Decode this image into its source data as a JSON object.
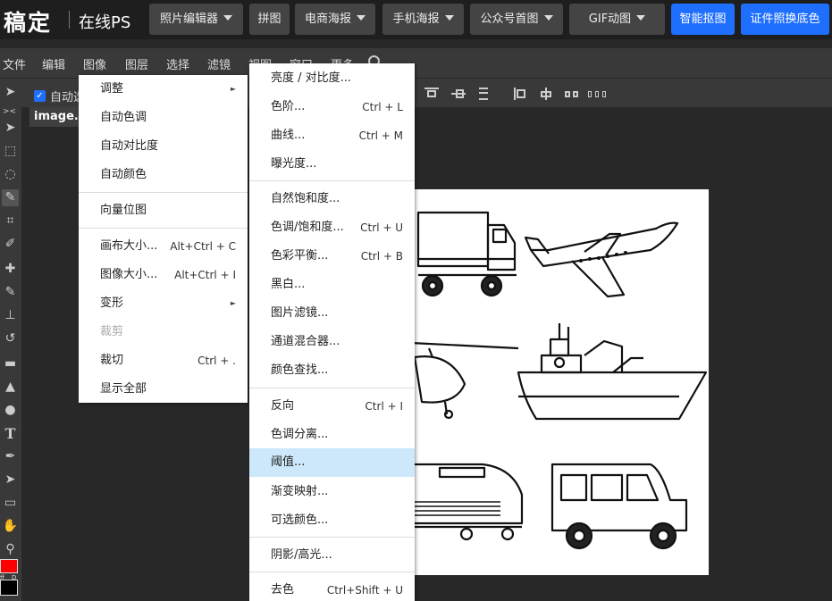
{
  "brand": {
    "logo": "稿定",
    "subtitle": "在线PS"
  },
  "top_nav": [
    {
      "label": "照片编辑器",
      "dropdown": true
    },
    {
      "label": "拼图",
      "dropdown": false
    },
    {
      "label": "电商海报",
      "dropdown": true
    },
    {
      "label": "手机海报",
      "dropdown": true
    },
    {
      "label": "公众号首图",
      "dropdown": true
    },
    {
      "label": "GIF动图",
      "dropdown": true
    },
    {
      "label": "智能抠图",
      "dropdown": false,
      "highlight": true
    },
    {
      "label": "证件照换底色",
      "dropdown": false,
      "highlight": true
    }
  ],
  "menubar": [
    "文件",
    "编辑",
    "图像",
    "图层",
    "选择",
    "滤镜",
    "视图",
    "窗口",
    "更多"
  ],
  "options": {
    "auto_select_label": "自动选",
    "auto_select_checked": true
  },
  "document": {
    "tab_label": "image.p"
  },
  "colors": {
    "foreground": "#ff0000",
    "background": "#000000",
    "accent": "#1f6fff"
  },
  "image_menu": {
    "items": [
      {
        "label": "调整",
        "submenu": true,
        "shortcut": ""
      },
      {
        "label": "自动色调",
        "shortcut": ""
      },
      {
        "label": "自动对比度",
        "shortcut": ""
      },
      {
        "label": "自动颜色",
        "shortcut": ""
      },
      {
        "label": "向量位图",
        "shortcut": ""
      },
      {
        "label": "画布大小...",
        "shortcut": "Alt+Ctrl + C"
      },
      {
        "label": "图像大小...",
        "shortcut": "Alt+Ctrl + I"
      },
      {
        "label": "变形",
        "submenu": true,
        "shortcut": ""
      },
      {
        "label": "裁剪",
        "shortcut": "",
        "disabled": true
      },
      {
        "label": "裁切",
        "shortcut": "Ctrl + ."
      },
      {
        "label": "显示全部",
        "shortcut": ""
      }
    ]
  },
  "adjust_menu": {
    "items": [
      {
        "label": "亮度 / 对比度...",
        "shortcut": ""
      },
      {
        "label": "色阶...",
        "shortcut": "Ctrl + L"
      },
      {
        "label": "曲线...",
        "shortcut": "Ctrl + M"
      },
      {
        "label": "曝光度...",
        "shortcut": ""
      },
      {
        "label": "自然饱和度...",
        "shortcut": ""
      },
      {
        "label": "色调/饱和度...",
        "shortcut": "Ctrl + U"
      },
      {
        "label": "色彩平衡...",
        "shortcut": "Ctrl + B"
      },
      {
        "label": "黑白...",
        "shortcut": ""
      },
      {
        "label": "图片滤镜...",
        "shortcut": ""
      },
      {
        "label": "通道混合器...",
        "shortcut": ""
      },
      {
        "label": "颜色查找...",
        "shortcut": ""
      },
      {
        "label": "反向",
        "shortcut": "Ctrl + I"
      },
      {
        "label": "色调分离...",
        "shortcut": ""
      },
      {
        "label": "阈值...",
        "shortcut": "",
        "highlighted": true
      },
      {
        "label": "渐变映射...",
        "shortcut": ""
      },
      {
        "label": "可选颜色...",
        "shortcut": ""
      },
      {
        "label": "阴影/高光...",
        "shortcut": ""
      },
      {
        "label": "去色",
        "shortcut": "Ctrl+Shift + U"
      }
    ]
  },
  "tools": [
    "move-tool",
    "marquee-tool",
    "lasso-tool",
    "quick-select-tool",
    "crop-tool",
    "eyedropper-tool",
    "healing-tool",
    "brush-tool",
    "stamp-tool",
    "history-brush-tool",
    "eraser-tool",
    "gradient-tool",
    "blur-tool",
    "dodge-tool",
    "type-tool",
    "pen-tool",
    "path-select-tool",
    "shape-tool",
    "hand-tool",
    "zoom-tool"
  ],
  "tool_glyphs": {
    "move": "➤",
    "marquee": "⬚",
    "lasso": "◌",
    "quick_select": "✎",
    "crop": "⌗",
    "eyedropper": "✐",
    "healing": "✚",
    "brush": "✎",
    "stamp": "⊥",
    "history": "↺",
    "eraser": "◇",
    "gradient": "▬",
    "blur": "▲",
    "dodge": "●",
    "type": "T",
    "pen": "✒",
    "path_select": "➤",
    "shape": "▭",
    "hand": "✋",
    "zoom": "⚲"
  },
  "color_swap_labels": [
    "ff",
    "D"
  ]
}
